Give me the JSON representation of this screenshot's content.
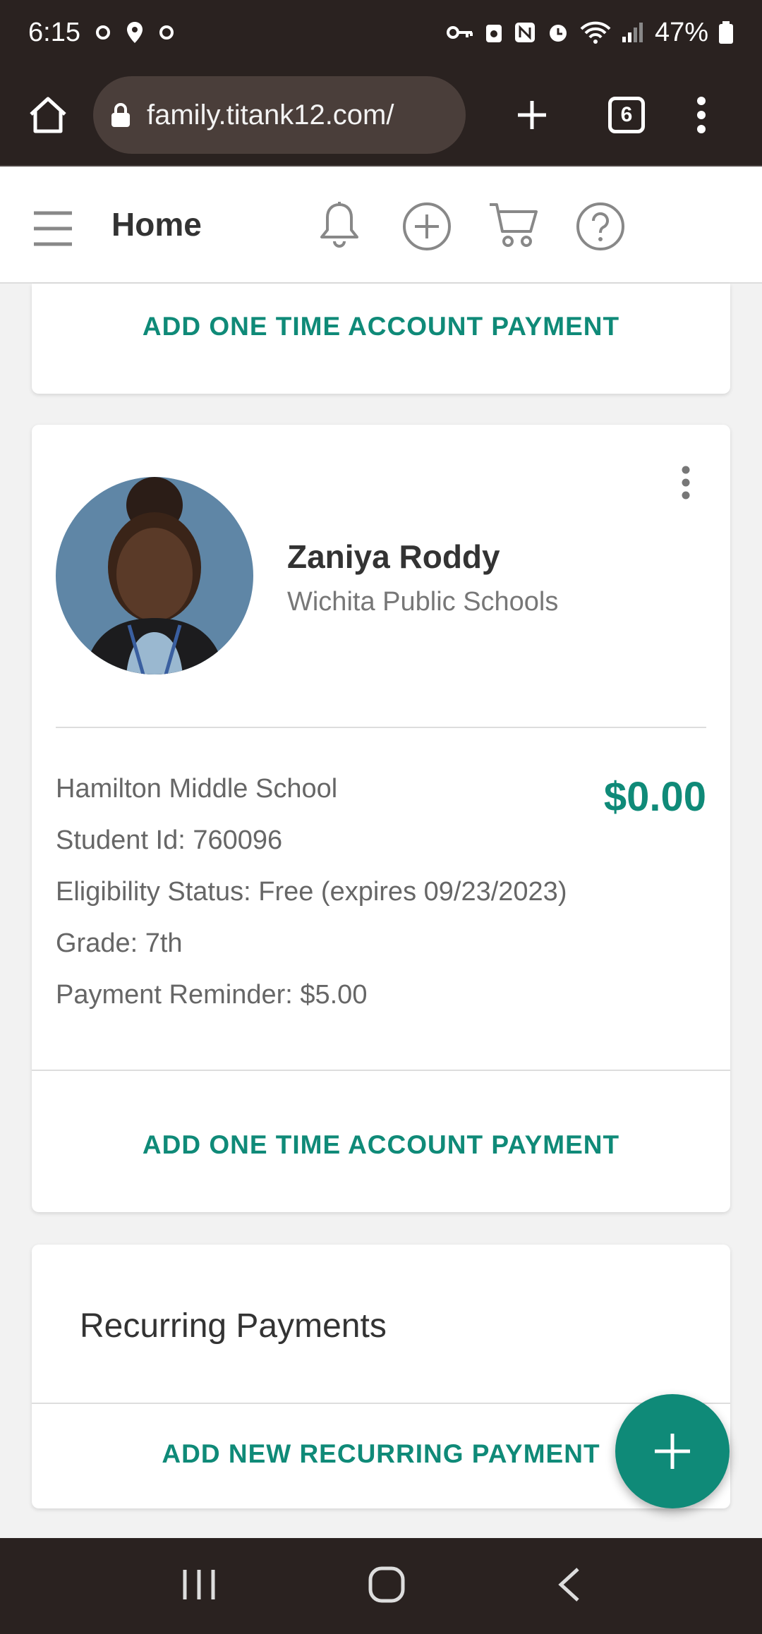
{
  "status_bar": {
    "time": "6:15",
    "battery": "47%"
  },
  "browser": {
    "url": "family.titank12.com/",
    "tab_count": "6"
  },
  "header": {
    "title": "Home"
  },
  "top_card": {
    "action_label": "ADD ONE TIME ACCOUNT PAYMENT"
  },
  "student": {
    "name": "Zaniya Roddy",
    "district": "Wichita Public Schools",
    "school": "Hamilton Middle School",
    "balance": "$0.00",
    "student_id": "Student Id: 760096",
    "eligibility": "Eligibility Status: Free (expires 09/23/2023)",
    "grade": "Grade: 7th",
    "payment_reminder": "Payment Reminder: $5.00",
    "action_label": "ADD ONE TIME ACCOUNT PAYMENT"
  },
  "recurring": {
    "title": "Recurring Payments",
    "action_label": "ADD NEW RECURRING PAYMENT"
  },
  "colors": {
    "accent": "#0f8a78",
    "chrome": "#2a2220"
  },
  "icons": {
    "fab": "plus-icon",
    "header": [
      "menu-icon",
      "bell-icon",
      "add-circle-icon",
      "cart-icon",
      "help-icon"
    ]
  }
}
